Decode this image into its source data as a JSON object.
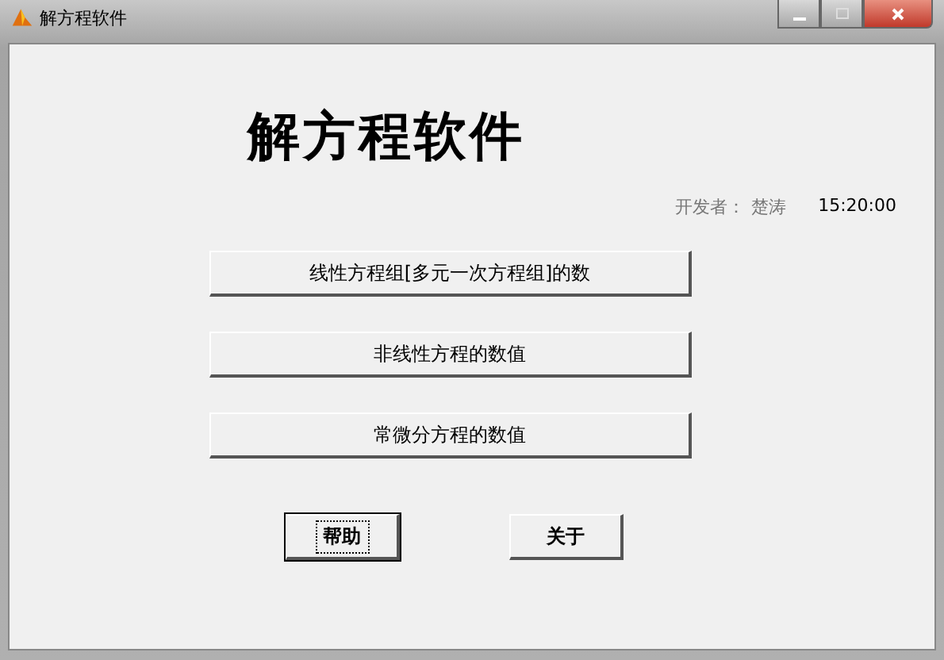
{
  "window": {
    "title": "解方程软件"
  },
  "heading": "解方程软件",
  "developer": {
    "label": "开发者：",
    "name": "楚涛",
    "time": "15:20:00"
  },
  "menu_buttons": [
    {
      "label": "线性方程组[多元一次方程组]的数"
    },
    {
      "label": "非线性方程的数值"
    },
    {
      "label": "常微分方程的数值"
    }
  ],
  "buttons": [
    {
      "label": "帮助",
      "focused": true
    },
    {
      "label": "关于",
      "focused": false
    }
  ]
}
